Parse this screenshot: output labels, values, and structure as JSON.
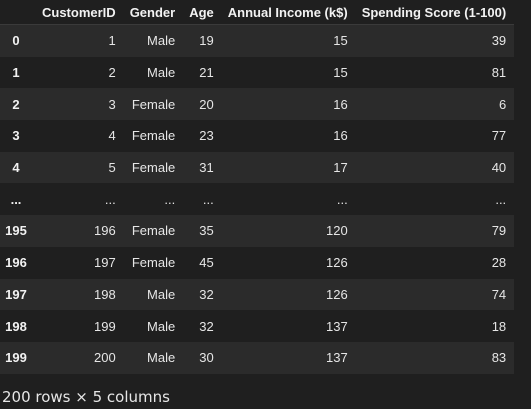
{
  "table": {
    "headers": [
      "",
      "CustomerID",
      "Gender",
      "Age",
      "Annual Income (k$)",
      "Spending Score (1-100)"
    ],
    "rows": [
      {
        "index": "0",
        "cells": [
          "1",
          "Male",
          "19",
          "15",
          "39"
        ]
      },
      {
        "index": "1",
        "cells": [
          "2",
          "Male",
          "21",
          "15",
          "81"
        ]
      },
      {
        "index": "2",
        "cells": [
          "3",
          "Female",
          "20",
          "16",
          "6"
        ]
      },
      {
        "index": "3",
        "cells": [
          "4",
          "Female",
          "23",
          "16",
          "77"
        ]
      },
      {
        "index": "4",
        "cells": [
          "5",
          "Female",
          "31",
          "17",
          "40"
        ]
      },
      {
        "index": "...",
        "cells": [
          "...",
          "...",
          "...",
          "...",
          "..."
        ]
      },
      {
        "index": "195",
        "cells": [
          "196",
          "Female",
          "35",
          "120",
          "79"
        ]
      },
      {
        "index": "196",
        "cells": [
          "197",
          "Female",
          "45",
          "126",
          "28"
        ]
      },
      {
        "index": "197",
        "cells": [
          "198",
          "Male",
          "32",
          "126",
          "74"
        ]
      },
      {
        "index": "198",
        "cells": [
          "199",
          "Male",
          "32",
          "137",
          "18"
        ]
      },
      {
        "index": "199",
        "cells": [
          "200",
          "Male",
          "30",
          "137",
          "83"
        ]
      }
    ]
  },
  "footer": {
    "shape_text": "200 rows × 5 columns"
  },
  "colors": {
    "background": "#1f1f1f",
    "row_alt": "#2b2b2b",
    "text": "#e6e6e6"
  }
}
